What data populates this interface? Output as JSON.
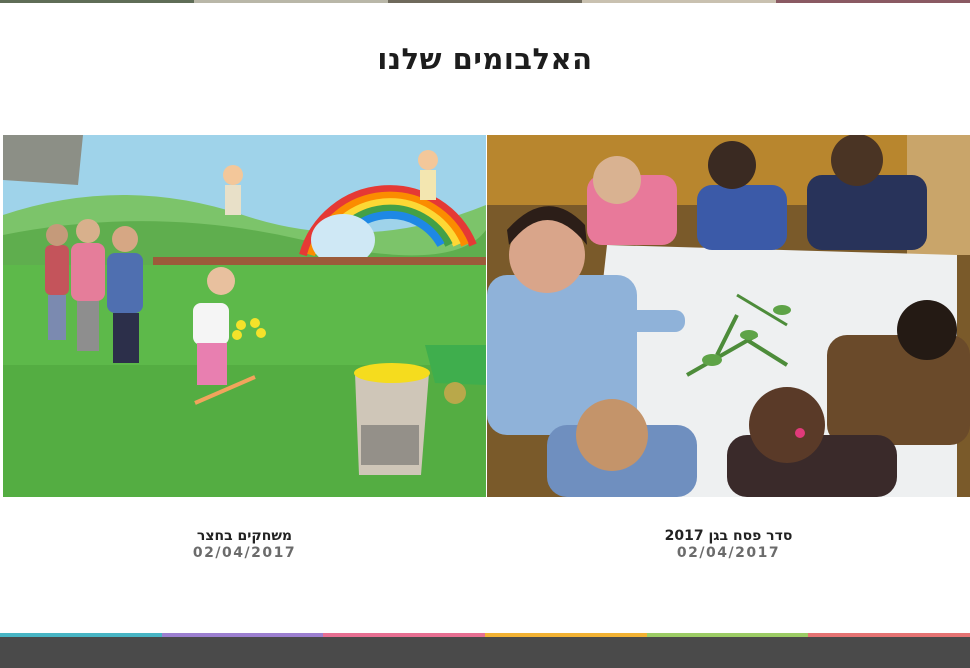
{
  "page": {
    "title": "האלבומים שלנו"
  },
  "albums": [
    {
      "name": "משחקים בחצר",
      "date": "02/04/2017",
      "photo_description_icon": "kids-playground-photo"
    },
    {
      "name": "סדר פסח בגן 2017",
      "date": "02/04/2017",
      "photo_description_icon": "passover-seder-photo"
    }
  ],
  "colors": {
    "stripe": [
      "#48b5c4",
      "#9ccc65",
      "#f4b400",
      "#e57373",
      "#ab47bc"
    ],
    "footer": "#4a4a4a",
    "title": "#1d1d1d",
    "date": "#6b6b6b"
  }
}
